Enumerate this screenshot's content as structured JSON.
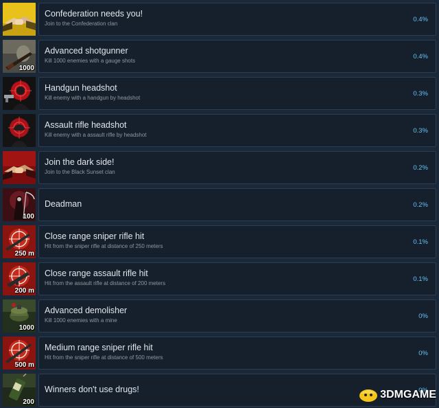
{
  "achievements": [
    {
      "title": "Confederation needs you!",
      "desc": "Join to the Confederation clan",
      "pct": "0.4%",
      "badge": "",
      "icon": "handshake-icon"
    },
    {
      "title": "Advanced shotgunner",
      "desc": "Kill 1000 enemies with a gauge shots",
      "pct": "0.4%",
      "badge": "1000",
      "icon": "shotgun-icon"
    },
    {
      "title": "Handgun headshot",
      "desc": "Kill enemy with a handgun by headshot",
      "pct": "0.3%",
      "badge": "",
      "icon": "handgun-headshot-icon"
    },
    {
      "title": "Assault rifle headshot",
      "desc": "Kill enemy with a assault rifle by headshot",
      "pct": "0.3%",
      "badge": "",
      "icon": "rifle-headshot-icon"
    },
    {
      "title": "Join the dark side!",
      "desc": "Join to the Black Sunset clan",
      "pct": "0.2%",
      "badge": "",
      "icon": "dark-handshake-icon"
    },
    {
      "title": "Deadman",
      "desc": "",
      "pct": "0.2%",
      "badge": "100",
      "icon": "reaper-icon"
    },
    {
      "title": "Close range sniper rifle hit",
      "desc": "Hit from the sniper rifle at distance of 250 meters",
      "pct": "0.1%",
      "badge": "250 m",
      "icon": "sniper-target-icon"
    },
    {
      "title": "Close range assault rifle hit",
      "desc": "Hit from the assault rifle at distance of 200 meters",
      "pct": "0.1%",
      "badge": "200 m",
      "icon": "assault-target-icon"
    },
    {
      "title": "Advanced demolisher",
      "desc": "Kill 1000 enemies with a mine",
      "pct": "0%",
      "badge": "1000",
      "icon": "mine-icon"
    },
    {
      "title": "Medium range sniper rifle hit",
      "desc": "Hit from the sniper rifle at distance of 500 meters",
      "pct": "0%",
      "badge": "500 m",
      "icon": "sniper-target-icon"
    },
    {
      "title": "Winners don't use drugs!",
      "desc": "",
      "pct": "0%",
      "badge": "200",
      "icon": "syringe-icon"
    }
  ],
  "watermark": "3DMGAME",
  "colors": {
    "background": "#1b2838",
    "panel": "#16202d",
    "border": "#2a3f55",
    "title": "#e1e6ec",
    "desc": "#8f98a0",
    "percent": "#66c0f4"
  }
}
